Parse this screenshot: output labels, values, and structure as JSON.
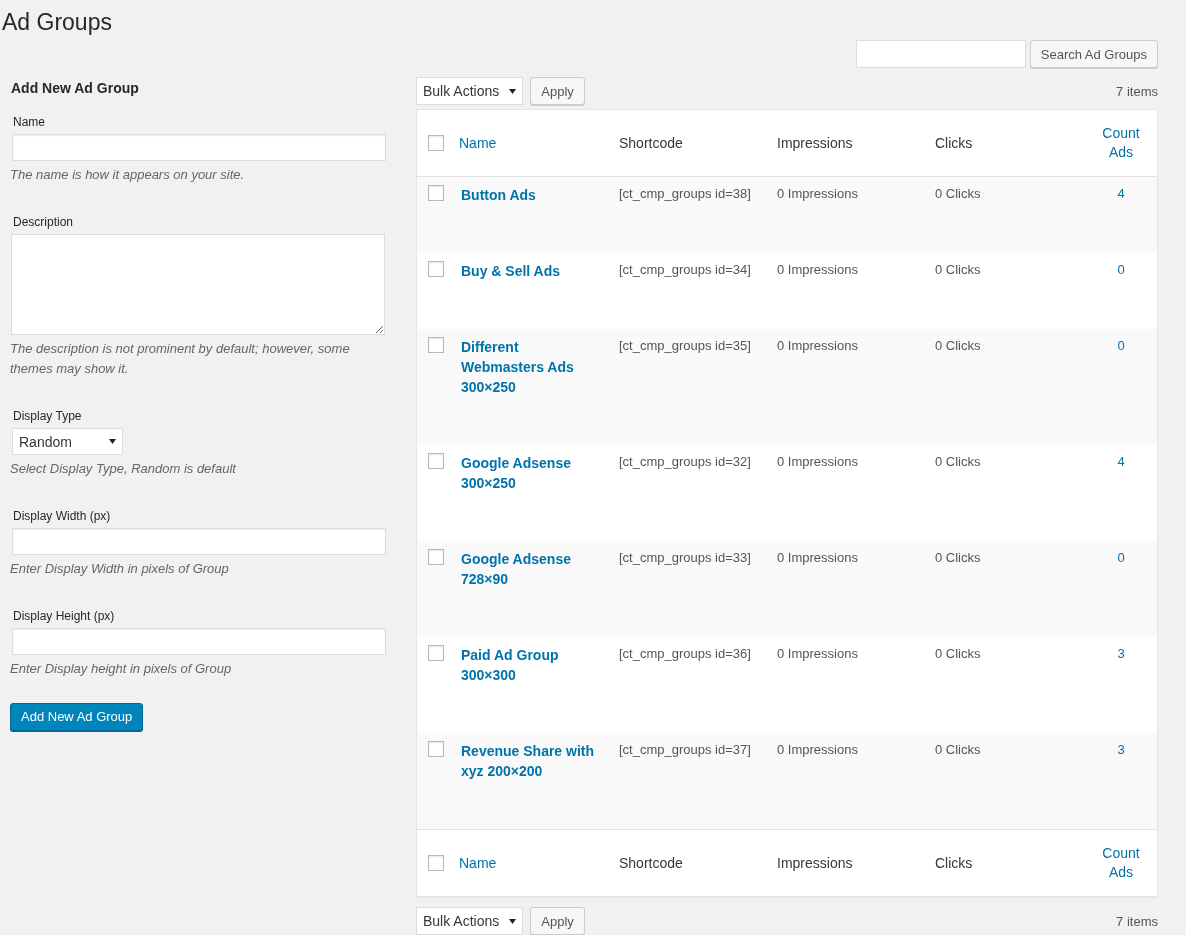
{
  "page_title": "Ad Groups",
  "search": {
    "button": "Search Ad Groups"
  },
  "form": {
    "title": "Add New Ad Group",
    "fields": [
      {
        "kind": "text",
        "label": "Name",
        "hint": "The name is how it appears on your site."
      },
      {
        "kind": "textarea",
        "label": "Description",
        "hint": "The description is not prominent by default; however, some themes may show it."
      },
      {
        "kind": "select",
        "label": "Display Type",
        "value": "Random",
        "hint": "Select Display Type, Random is default"
      },
      {
        "kind": "text",
        "label": "Display Width (px)",
        "hint": "Enter Display Width in pixels of Group"
      },
      {
        "kind": "text",
        "label": "Display Height (px)",
        "hint": "Enter Display height in pixels of Group"
      }
    ],
    "submit": "Add New Ad Group"
  },
  "top_nav": {
    "bulk_actions": "Bulk Actions",
    "apply": "Apply",
    "count": "7 items"
  },
  "table": {
    "select_all_checked": false,
    "columns": [
      {
        "label": "Name",
        "sortable": true
      },
      {
        "label": "Shortcode",
        "sortable": false
      },
      {
        "label": "Impressions",
        "sortable": false
      },
      {
        "label": "Clicks",
        "sortable": false
      },
      {
        "label": "Count Ads",
        "sortable": true
      }
    ],
    "rows": [
      {
        "checked": false,
        "name": "Button Ads",
        "shortcode": "[ct_cmp_groups id=38]",
        "impressions": "0 Impressions",
        "clicks": "0 Clicks",
        "count": "4"
      },
      {
        "checked": false,
        "name": "Buy & Sell Ads",
        "shortcode": "[ct_cmp_groups id=34]",
        "impressions": "0 Impressions",
        "clicks": "0 Clicks",
        "count": "0"
      },
      {
        "checked": false,
        "name": "Different Webmasters Ads 300×250",
        "shortcode": "[ct_cmp_groups id=35]",
        "impressions": "0 Impressions",
        "clicks": "0 Clicks",
        "count": "0"
      },
      {
        "checked": false,
        "name": "Google Adsense 300×250",
        "shortcode": "[ct_cmp_groups id=32]",
        "impressions": "0 Impressions",
        "clicks": "0 Clicks",
        "count": "4"
      },
      {
        "checked": false,
        "name": "Google Adsense 728×90",
        "shortcode": "[ct_cmp_groups id=33]",
        "impressions": "0 Impressions",
        "clicks": "0 Clicks",
        "count": "0"
      },
      {
        "checked": false,
        "name": "Paid Ad Group 300×300",
        "shortcode": "[ct_cmp_groups id=36]",
        "impressions": "0 Impressions",
        "clicks": "0 Clicks",
        "count": "3"
      },
      {
        "checked": false,
        "name": "Revenue Share with xyz 200×200",
        "shortcode": "[ct_cmp_groups id=37]",
        "impressions": "0 Impressions",
        "clicks": "0 Clicks",
        "count": "3"
      }
    ],
    "footer_select_all_checked": false,
    "footer_columns": [
      {
        "label": "Name",
        "sortable": true
      },
      {
        "label": "Shortcode",
        "sortable": false
      },
      {
        "label": "Impressions",
        "sortable": false
      },
      {
        "label": "Clicks",
        "sortable": false
      },
      {
        "label": "Count Ads",
        "sortable": true
      }
    ]
  },
  "bottom_nav": {
    "bulk_actions": "Bulk Actions",
    "apply": "Apply",
    "count": "7 items"
  }
}
